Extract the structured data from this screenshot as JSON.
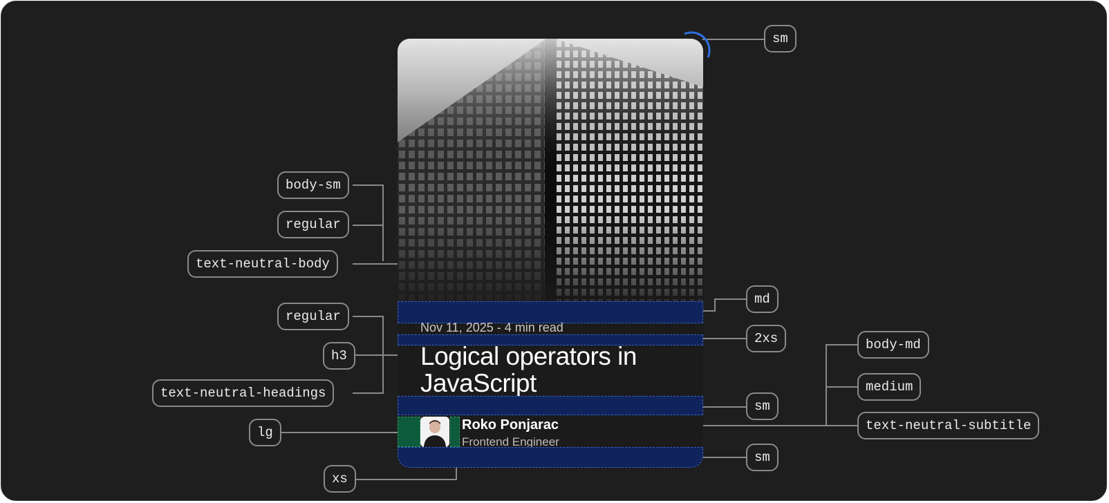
{
  "article": {
    "meta": "Nov 11, 2025 - 4 min read",
    "title_line1": "Logical operators in",
    "title_line2": "JavaScript",
    "author_name": "Roko Ponjarac",
    "author_role": "Frontend Engineer"
  },
  "annotations": {
    "radius": "sm",
    "image_gap": "md",
    "meta_gap": "2xs",
    "title_gap": "sm",
    "bottom_padding": "sm",
    "meta_size": "body-sm",
    "meta_weight": "regular",
    "meta_color": "text-neutral-body",
    "title_weight": "regular",
    "title_level": "h3",
    "title_color": "text-neutral-headings",
    "avatar_size": "lg",
    "avatar_gap": "xs",
    "author_size": "body-md",
    "author_weight": "medium",
    "author_color": "text-neutral-subtitle"
  },
  "colors": {
    "background": "#1e1e1e",
    "spacing_band": "#10235c",
    "avatar_spacing": "#0e5a3c",
    "radius_marker": "#2f6fe0"
  }
}
